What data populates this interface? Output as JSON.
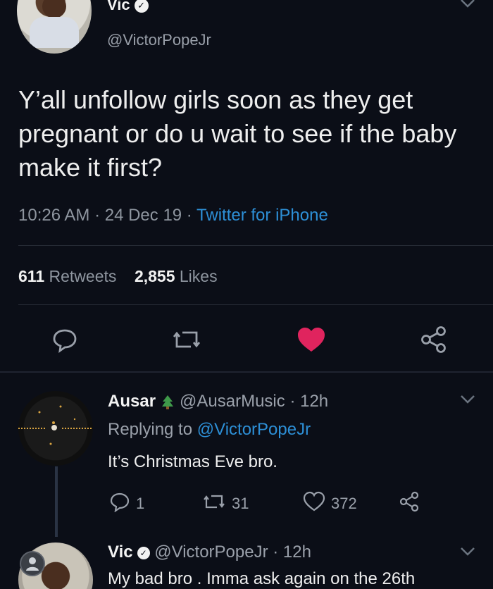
{
  "main_tweet": {
    "name": "Vic",
    "handle": "@VictorPopeJr",
    "text": "Y’all unfollow girls soon as they get pregnant or do u wait to see if the baby make it first?",
    "time": "10:26 AM",
    "date": "24 Dec 19",
    "separator": " · ",
    "client": "Twitter for iPhone",
    "retweets_count": "611",
    "retweets_label": "Retweets",
    "likes_count": "2,855",
    "likes_label": "Likes",
    "liked": true,
    "like_color": "#e0245e"
  },
  "reply": {
    "name": "Ausar",
    "handle": "@AusarMusic",
    "age": "· 12h",
    "replying_prefix": "Replying to",
    "replying_to": "@VictorPopeJr",
    "text": "It’s Christmas Eve bro.",
    "reply_count": "1",
    "retweet_count": "31",
    "like_count": "372"
  },
  "reply2": {
    "name": "Vic",
    "handle": "@VictorPopeJr",
    "age": "· 12h",
    "text": "My bad bro . Imma ask again on the 26th"
  },
  "accent_color": "#2d8fd6",
  "icons": [
    "verified-icon",
    "chevron-down-icon",
    "reply-icon",
    "retweet-icon",
    "heart-icon",
    "share-icon",
    "tree-icon",
    "profile-icon"
  ]
}
